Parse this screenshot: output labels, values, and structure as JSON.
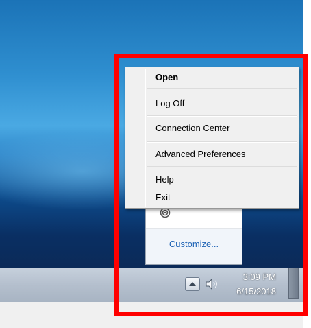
{
  "context_menu": {
    "items": [
      {
        "label": "Open"
      },
      {
        "label": "Log Off"
      },
      {
        "label": "Connection Center"
      },
      {
        "label": "Advanced Preferences"
      },
      {
        "label": "Help"
      },
      {
        "label": "Exit"
      }
    ]
  },
  "overflow_panel": {
    "icon": "receiver-swirl-icon",
    "customize_label": "Customize..."
  },
  "taskbar": {
    "tray_arrow_icon": "chevron-up-icon",
    "volume_icon": "speaker-icon",
    "clock_time": "3:09 PM",
    "clock_date": "6/15/2018"
  },
  "highlight": {
    "color": "#ff0000"
  }
}
